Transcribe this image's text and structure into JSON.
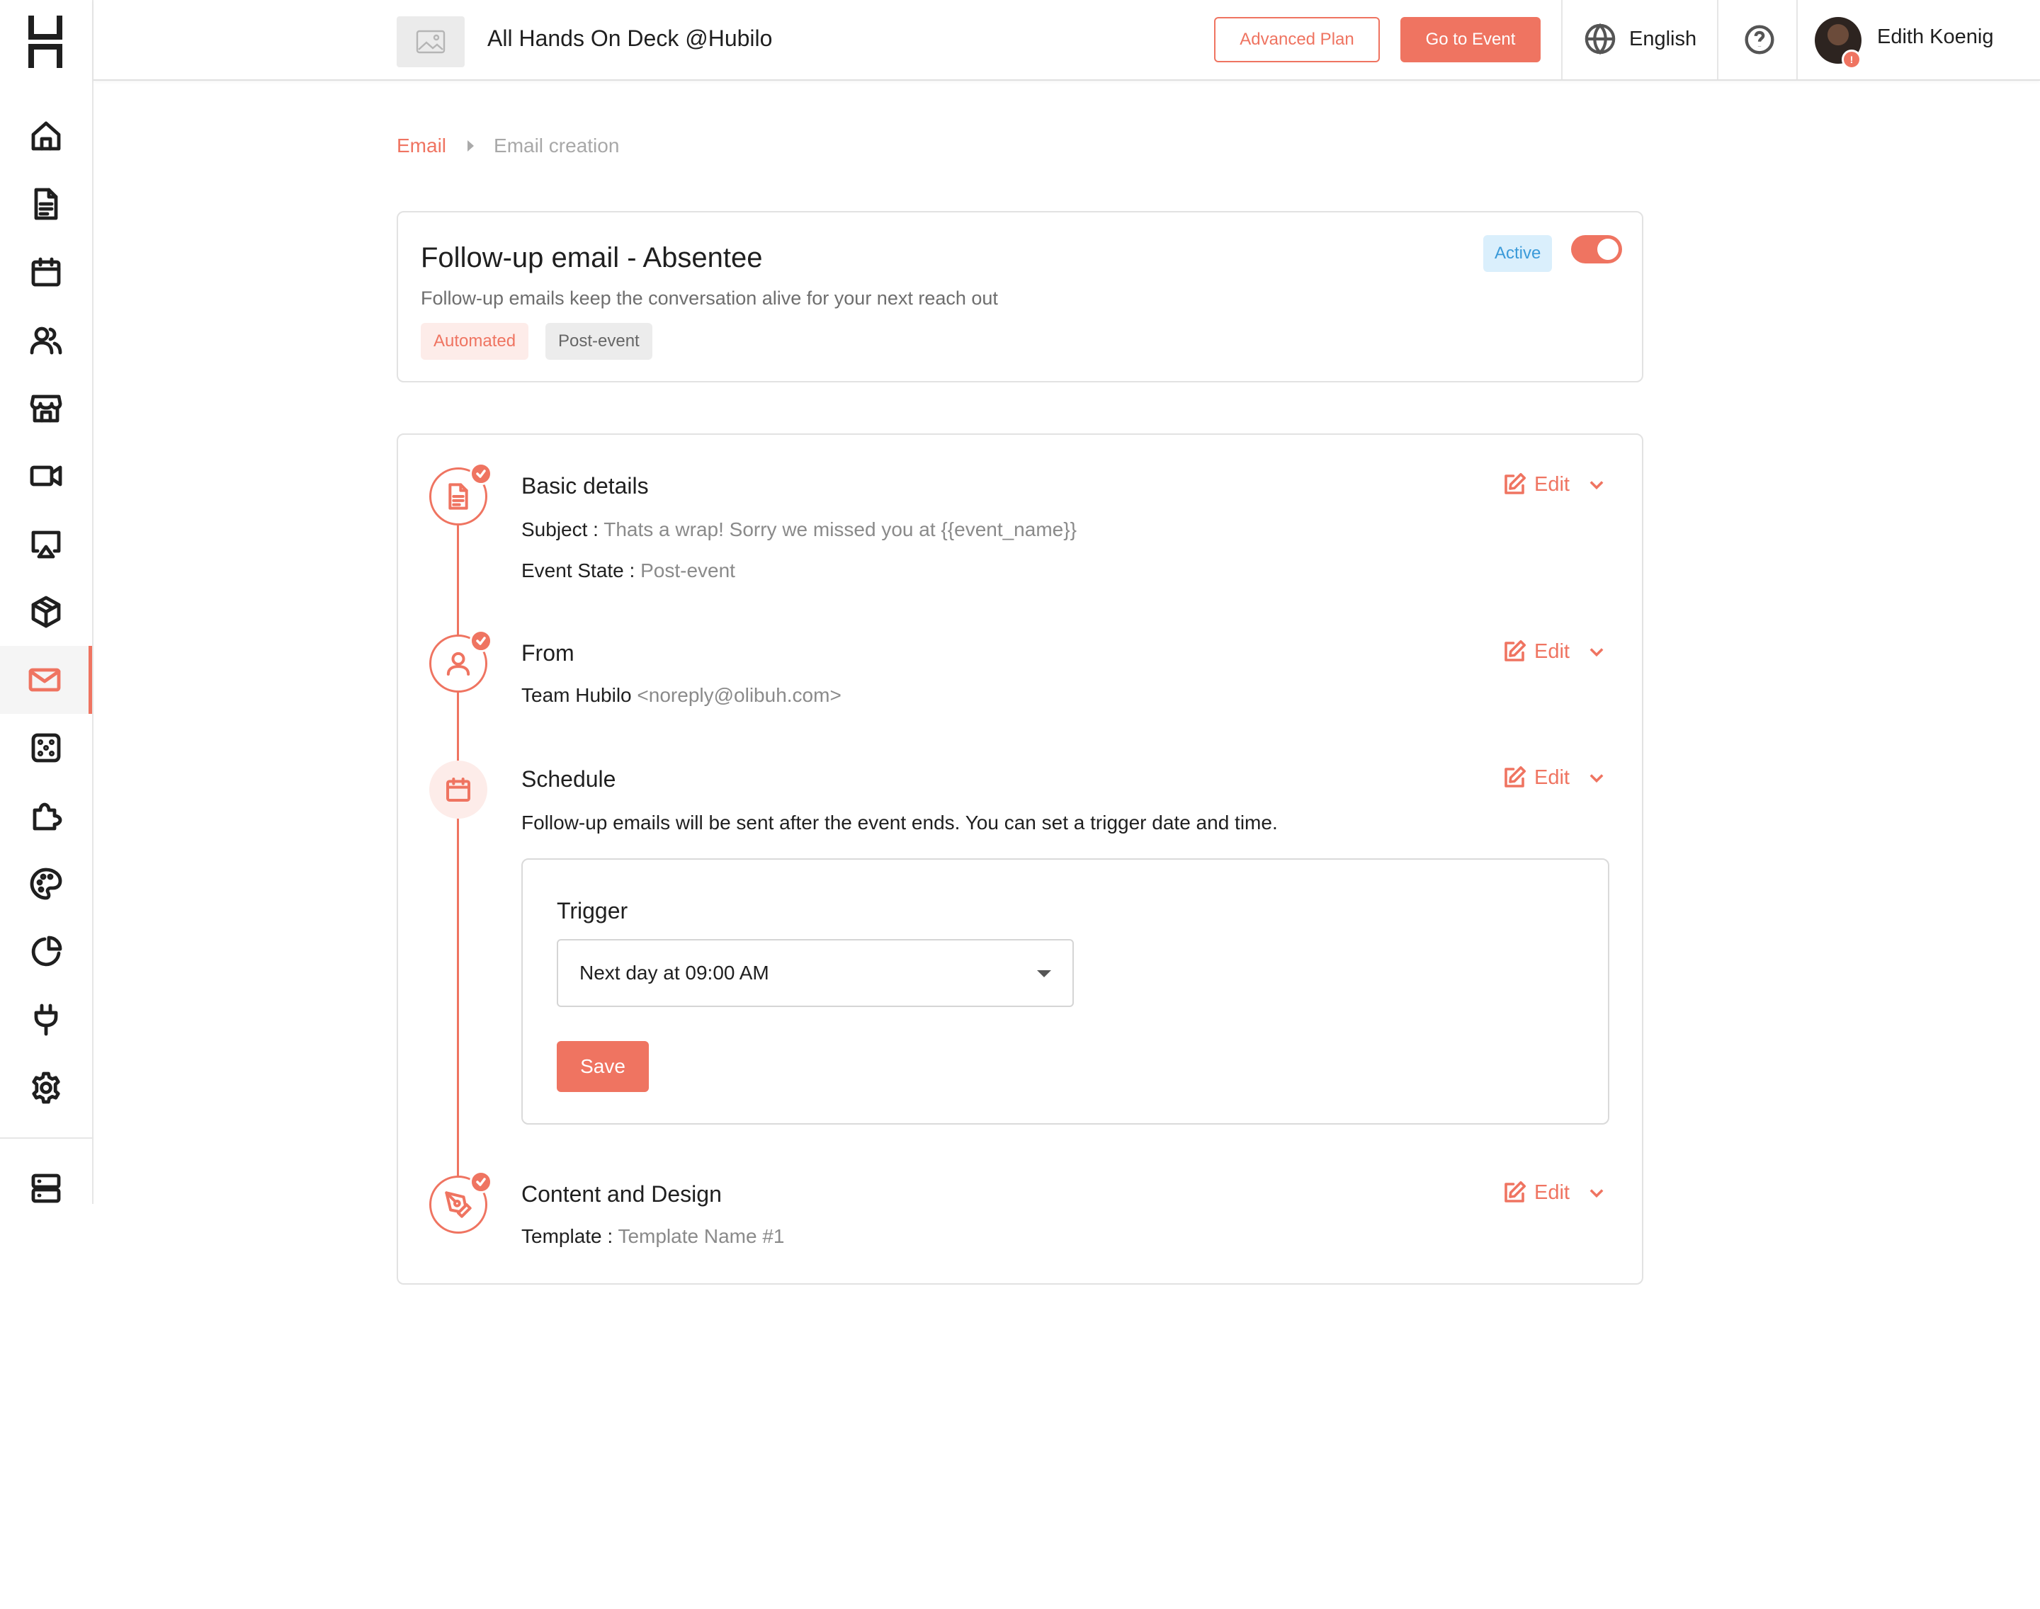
{
  "header": {
    "event_title": "All Hands On Deck @Hubilo",
    "advanced_plan_label": "Advanced Plan",
    "go_to_event_label": "Go to Event",
    "language": "English",
    "user_name": "Edith Koenig"
  },
  "sidebar": {
    "items": [
      {
        "name": "home-icon"
      },
      {
        "name": "document-icon"
      },
      {
        "name": "calendar-icon"
      },
      {
        "name": "people-icon"
      },
      {
        "name": "store-icon"
      },
      {
        "name": "video-icon"
      },
      {
        "name": "screen-cast-icon"
      },
      {
        "name": "box-icon"
      },
      {
        "name": "mail-icon",
        "active": true
      },
      {
        "name": "dice-icon"
      },
      {
        "name": "puzzle-icon"
      },
      {
        "name": "palette-icon"
      },
      {
        "name": "pie-chart-icon"
      },
      {
        "name": "plug-icon"
      },
      {
        "name": "gear-icon"
      },
      {
        "name": "server-icon"
      }
    ]
  },
  "breadcrumb": {
    "parent": "Email",
    "current": "Email creation"
  },
  "summary": {
    "title": "Follow-up email - Absentee",
    "description": "Follow-up emails keep the conversation alive for your next reach out",
    "tags": [
      "Automated",
      "Post-event"
    ],
    "status": "Active",
    "enabled": true
  },
  "steps": {
    "edit_label": "Edit",
    "basic": {
      "title": "Basic details",
      "subject_label": "Subject :",
      "subject_value": "Thats a wrap! Sorry we missed you at {{event_name}}",
      "state_label": "Event State :",
      "state_value": "Post-event"
    },
    "from": {
      "title": "From",
      "name": "Team Hubilo",
      "email": "<noreply@olibuh.com>"
    },
    "schedule": {
      "title": "Schedule",
      "description": "Follow-up emails will be sent after the event ends. You can set a trigger date and time.",
      "trigger_label": "Trigger",
      "trigger_value": "Next day at 09:00 AM",
      "save_label": "Save"
    },
    "content": {
      "title": "Content and Design",
      "template_label": "Template :",
      "template_value": "Template Name #1"
    }
  },
  "colors": {
    "accent": "#ef7461",
    "status_badge_bg": "#daeffc",
    "status_badge_text": "#3a9ad9"
  }
}
